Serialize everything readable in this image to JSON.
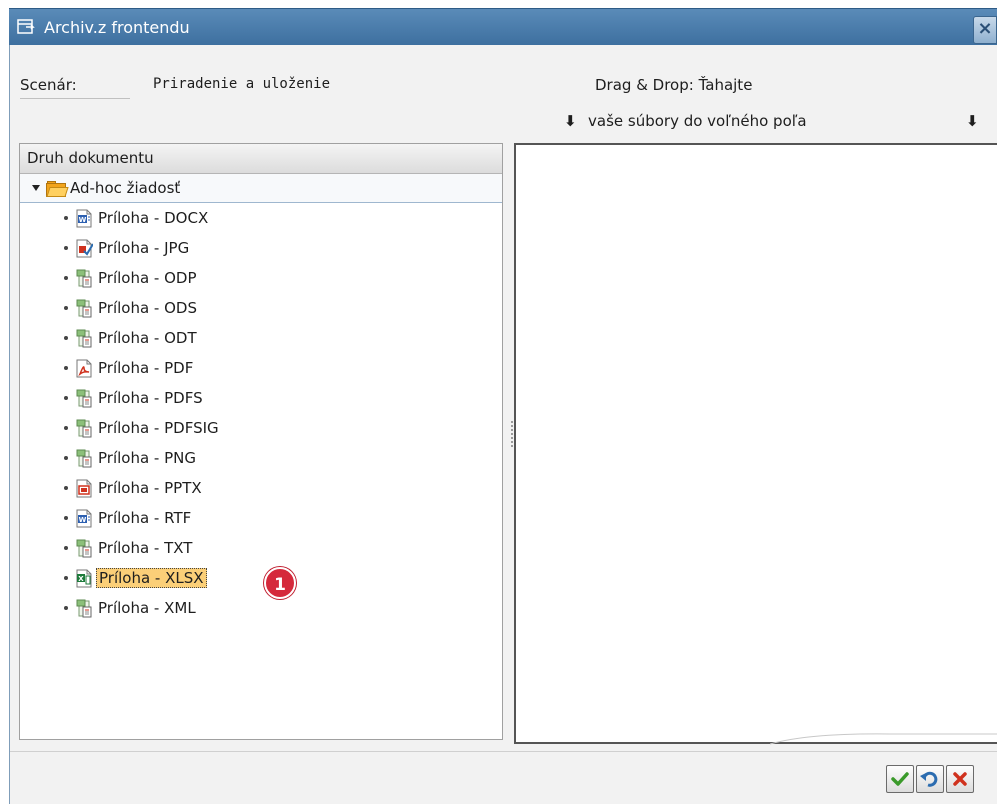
{
  "window": {
    "title": "Archiv.z frontendu",
    "close_label": "×"
  },
  "form": {
    "scenario_label": "Scenár:",
    "scenario_value": "Priradenie a uloženie",
    "dragdrop_line1": "Drag & Drop: Ťahajte",
    "dragdrop_line2": "vaše súbory do voľného poľa",
    "arrow_glyph": "⬇"
  },
  "tree": {
    "header": "Druh dokumentu",
    "root_label": "Ad-hoc žiadosť",
    "items": [
      {
        "label": "Príloha - DOCX",
        "icon": "word-document-icon"
      },
      {
        "label": "Príloha - JPG",
        "icon": "image-document-icon"
      },
      {
        "label": "Príloha - ODP",
        "icon": "generic-document-icon"
      },
      {
        "label": "Príloha - ODS",
        "icon": "generic-document-icon"
      },
      {
        "label": "Príloha - ODT",
        "icon": "generic-document-icon"
      },
      {
        "label": "Príloha - PDF",
        "icon": "pdf-document-icon"
      },
      {
        "label": "Príloha - PDFS",
        "icon": "generic-document-icon"
      },
      {
        "label": "Príloha - PDFSIG",
        "icon": "generic-document-icon"
      },
      {
        "label": "Príloha - PNG",
        "icon": "generic-document-icon"
      },
      {
        "label": "Príloha - PPTX",
        "icon": "powerpoint-document-icon"
      },
      {
        "label": "Príloha - RTF",
        "icon": "word-document-icon"
      },
      {
        "label": "Príloha - TXT",
        "icon": "generic-document-icon"
      },
      {
        "label": "Príloha - XLSX",
        "icon": "excel-document-icon",
        "selected": true
      },
      {
        "label": "Príloha - XML",
        "icon": "generic-document-icon"
      }
    ]
  },
  "annotation": {
    "badge_number": "1"
  },
  "colors": {
    "titlebar": "#4a7cab",
    "selection": "#fbcf78",
    "badge": "#d5293b"
  }
}
